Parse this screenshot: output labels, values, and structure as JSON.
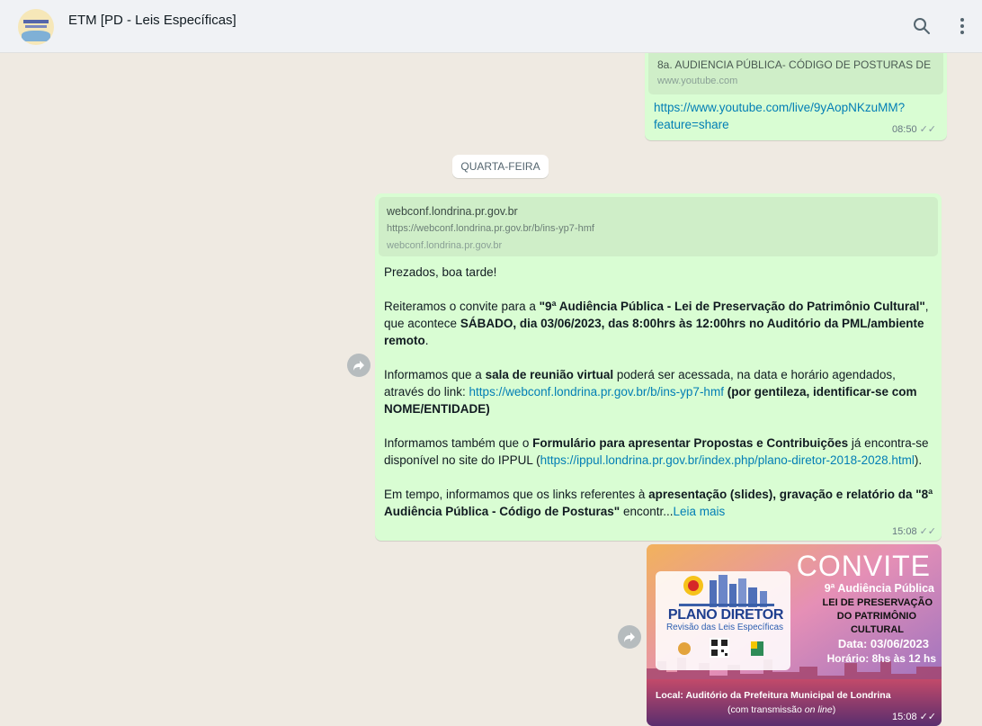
{
  "header": {
    "title": "ETM [PD - Leis Específicas]",
    "search_icon": "search-icon",
    "menu_icon": "kebab-menu-icon"
  },
  "msg1": {
    "preview_title": "8a. AUDIENCIA PÚBLICA- CÓDIGO DE POSTURAS DE",
    "preview_site": "www.youtube.com",
    "link_line1": "https://www.youtube.com/live/9yAopNKzuMM?",
    "link_line2": "feature=share",
    "time": "08:50"
  },
  "day_separator": "QUARTA-FEIRA",
  "msg2": {
    "preview_title": "webconf.londrina.pr.gov.br",
    "preview_url": "https://webconf.londrina.pr.gov.br/b/ins-yp7-hmf",
    "preview_site": "webconf.londrina.pr.gov.br",
    "greeting": "Prezados, boa tarde!",
    "p2_a": "Reiteramos o convite para a ",
    "p2_b": "\"9ª Audiência Pública - Lei de Preservação do Patrimônio Cultural\"",
    "p2_c": ", que acontece ",
    "p2_d": "SÁBADO, dia 03/06/2023, das 8:00hrs às 12:00hrs no Auditório da PML/ambiente remoto",
    "p2_e": ".",
    "p3_a": "Informamos que a ",
    "p3_b": "sala de reunião virtual",
    "p3_c": " poderá ser acessada, na data e horário agendados, através do link: ",
    "p3_link": "https://webconf.londrina.pr.gov.br/b/ins-yp7-hmf",
    "p3_d": " (por gentileza, identificar-se com NOME/ENTIDADE)",
    "p4_a": "Informamos também que o ",
    "p4_b": "Formulário para apresentar Propostas e Contribuições",
    "p4_c": " já encontra-se disponível no site do IPPUL (",
    "p4_link": "https://ippul.londrina.pr.gov.br/index.php/plano-diretor-2018-2028.html",
    "p4_d": ").",
    "p5_a": "Em tempo, informamos que os links referentes à ",
    "p5_b": "apresentação (slides), gravação e relatório da \"8ª Audiência Pública - Código de Posturas\"",
    "p5_c": " encontr...",
    "read_more": "Leia mais",
    "time": "15:08"
  },
  "msg3": {
    "convite": "CONVITE",
    "line1": "9ª Audiência Pública",
    "line2": "LEI DE PRESERVAÇÃO",
    "line3": "DO PATRIMÔNIO",
    "line4": "CULTURAL",
    "date": "Data: 03/06/2023",
    "hours": "Horário: 8hs às 12 hs",
    "logo_title": "PLANO DIRETOR",
    "logo_sub": "Revisão das Leis Específicas",
    "local": "Local: Auditório da Prefeitura Municipal de Londrina",
    "transmission_a": "(com transmissão ",
    "transmission_b": "on line",
    "transmission_c": ")",
    "time": "15:08"
  },
  "colors": {
    "outgoing_bubble": "#d9fdd3",
    "link": "#027eb5",
    "background": "#efeae2",
    "header": "#f0f2f5"
  }
}
